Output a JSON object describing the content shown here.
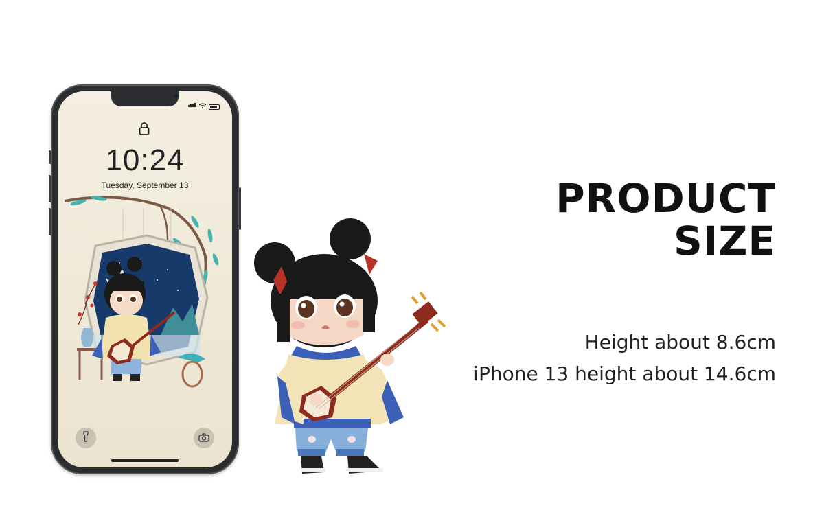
{
  "heading": {
    "line1": "PRODUCT",
    "line2": "SIZE"
  },
  "specs": {
    "figure_height": "Height about 8.6cm",
    "phone_height": "iPhone 13 height about 14.6cm"
  },
  "phone": {
    "time": "10:24",
    "date": "Tuesday, September 13",
    "icons": [
      "signal-icon",
      "wifi-icon",
      "battery-icon",
      "lock-icon",
      "flashlight-icon",
      "camera-icon"
    ]
  },
  "colors": {
    "phone_frame": "#2c2d30",
    "screen_paper": "#f1ead9",
    "figure_robe": "#f3e4b8",
    "figure_blue": "#3c5fb8",
    "instrument_red": "#8e2a1e"
  }
}
